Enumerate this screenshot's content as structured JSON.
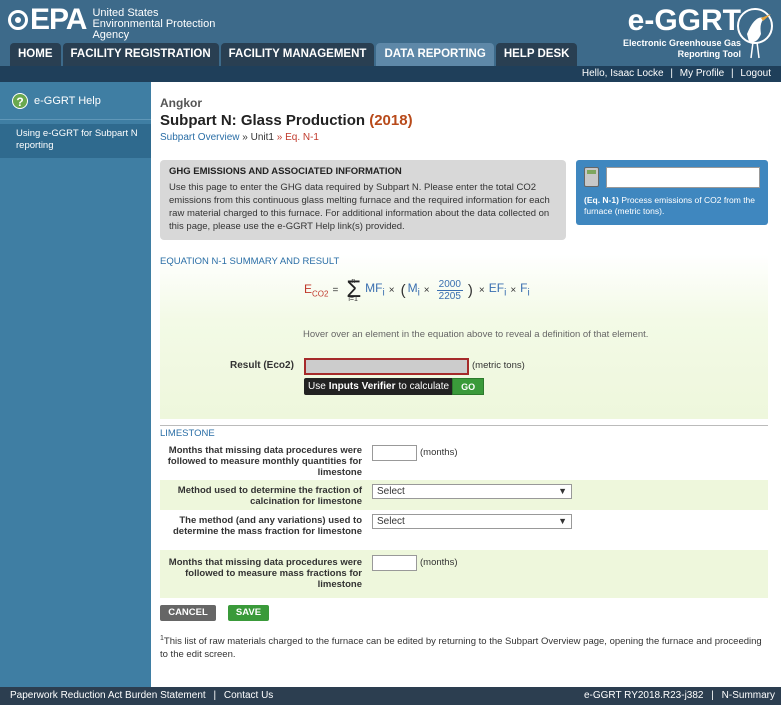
{
  "header": {
    "epa_mark": "EPA",
    "epa_line1": "United States",
    "epa_line2": "Environmental Protection",
    "epa_line3": "Agency",
    "app_title": "e-GGRT",
    "app_sub1": "Electronic Greenhouse Gas",
    "app_sub2": "Reporting Tool"
  },
  "nav": {
    "tabs": [
      {
        "label": "HOME"
      },
      {
        "label": "FACILITY REGISTRATION"
      },
      {
        "label": "FACILITY MANAGEMENT"
      },
      {
        "label": "DATA REPORTING"
      },
      {
        "label": "HELP DESK"
      }
    ],
    "active": 3
  },
  "userbar": {
    "greeting": "Hello, Isaac Locke",
    "profile": "My Profile",
    "logout": "Logout"
  },
  "sidebar": {
    "help_title": "e-GGRT Help",
    "help_link": "Using e-GGRT for Subpart N reporting"
  },
  "page": {
    "facility": "Angkor",
    "title": "Subpart N: Glass Production",
    "year": "(2018)",
    "crumb_overview": "Subpart Overview",
    "crumb_sep1": "»",
    "crumb_unit": "Unit1",
    "crumb_sep2": "»",
    "crumb_current": "Eq. N-1"
  },
  "info": {
    "heading": "GHG EMISSIONS AND ASSOCIATED INFORMATION",
    "body": "Use this page to enter the GHG data required by Subpart N. Please enter the total CO2 emissions from this continuous glass melting furnace and the required information for each raw material charged to this furnace. For additional information about the data collected on this page, please use the e-GGRT Help link(s) provided."
  },
  "eq_box": {
    "tag": "(Eq. N-1)",
    "desc": "Process emissions of CO2 from the furnace (metric tons)."
  },
  "equation": {
    "section_title": "EQUATION N-1 SUMMARY AND RESULT",
    "lhs": "E",
    "lhs_sub": "CO2",
    "eq": "=",
    "sum_top": "n",
    "sum_bot": "i=1",
    "mf": "MF",
    "mf_sub": "i",
    "times": "×",
    "open": "(",
    "m": "M",
    "m_sub": "i",
    "num": "2000",
    "den": "2205",
    "close": ")",
    "ef": "EF",
    "ef_sub": "i",
    "f": "F",
    "f_sub": "i",
    "hover_text": "Hover over an element in the equation above to reveal a definition of that element.",
    "result_label": "Result (Eco2)",
    "result_units": "(metric tons)",
    "verifier_pre": "Use",
    "verifier_bold": "Inputs Verifier",
    "verifier_post": "to calculate",
    "go": "GO"
  },
  "limestone": {
    "section_title": "LIMESTONE",
    "rows": [
      {
        "label": "Months that missing data procedures were followed to measure monthly quantities for limestone",
        "units": "(months)"
      },
      {
        "label": "Method used to determine the fraction of calcination for limestone",
        "select": "Select"
      },
      {
        "label": "The method (and any variations) used to determine the mass fraction for limestone",
        "select": "Select"
      },
      {
        "label": "Months that missing data procedures were followed to measure mass fractions for limestone",
        "units": "(months)"
      }
    ]
  },
  "buttons": {
    "cancel": "CANCEL",
    "save": "SAVE"
  },
  "footnote": {
    "mark": "1",
    "text": "This list of raw materials charged to the furnace can be edited by returning to the Subpart Overview page, opening the furnace and proceeding to the edit screen."
  },
  "footer": {
    "burden": "Paperwork Reduction Act Burden Statement",
    "contact": "Contact Us",
    "version": "e-GGRT RY2018.R23-j382",
    "summary": "N-Summary"
  },
  "colors": {
    "header_bg": "#3d6a8a",
    "sidebar_bg": "#3f7ea3",
    "accent_green": "#3a9a3a",
    "year_color": "#b84a1a"
  }
}
